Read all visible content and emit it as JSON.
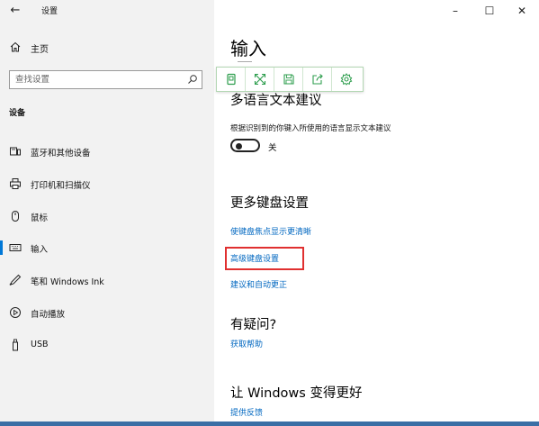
{
  "window": {
    "app_title": "设置",
    "controls": {
      "minimize": "–",
      "maximize": "☐",
      "close": "✕"
    }
  },
  "sidebar": {
    "home_label": "主页",
    "search": {
      "placeholder": "查找设置"
    },
    "section_label": "设备",
    "items": [
      {
        "label": "蓝牙和其他设备",
        "icon": "bluetooth-devices-icon"
      },
      {
        "label": "打印机和扫描仪",
        "icon": "printer-icon"
      },
      {
        "label": "鼠标",
        "icon": "mouse-icon"
      },
      {
        "label": "输入",
        "icon": "keyboard-icon",
        "selected": true
      },
      {
        "label": "笔和 Windows Ink",
        "icon": "pen-icon"
      },
      {
        "label": "自动播放",
        "icon": "autoplay-icon"
      },
      {
        "label": "USB",
        "icon": "usb-icon"
      }
    ]
  },
  "main": {
    "page_title": "输入",
    "multilang": {
      "heading": "多语言文本建议",
      "description": "根据识别到的你键入所使用的语言显示文本建议",
      "toggle_label": "关",
      "toggle_on": false
    },
    "more_keyboard": {
      "heading": "更多键盘设置",
      "links": [
        "使键盘焦点显示更清晰",
        "高级键盘设置",
        "建议和自动更正"
      ]
    },
    "questions": {
      "heading": "有疑问?",
      "link": "获取帮助"
    },
    "improve": {
      "heading": "让 Windows 变得更好",
      "link": "提供反馈"
    }
  },
  "colors": {
    "accent": "#0078d7",
    "link": "#0067c0",
    "highlight": "#e03030",
    "toolbar_icon": "#2e9e4e"
  }
}
